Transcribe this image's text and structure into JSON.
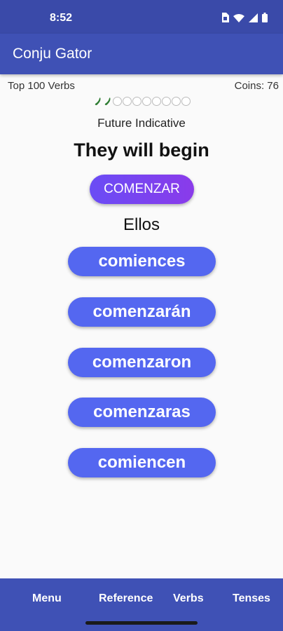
{
  "status": {
    "time": "8:52"
  },
  "app": {
    "title": "Conju Gator"
  },
  "info": {
    "deck": "Top 100 Verbs",
    "coins": "Coins: 76"
  },
  "progress": {
    "completed": 2,
    "total": 10
  },
  "question": {
    "tense": "Future Indicative",
    "prompt": "They will begin",
    "verb": "COMENZAR",
    "pronoun": "Ellos"
  },
  "answers": [
    "comiences",
    "comenzarán",
    "comenzaron",
    "comenzaras",
    "comiencen"
  ],
  "nav": {
    "menu": "Menu",
    "reference": "Reference",
    "verbs": "Verbs",
    "tenses": "Tenses"
  },
  "colors": {
    "primary": "#3f51b5",
    "answer": "#5467f0",
    "verb_gradient": [
      "#6a4cf5",
      "#8a3bea"
    ],
    "pepper": "#2e7d32"
  }
}
